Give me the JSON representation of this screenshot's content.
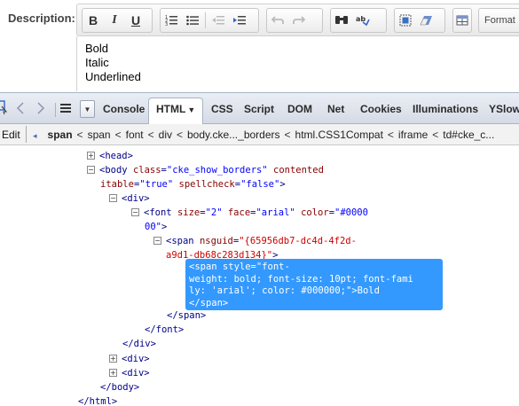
{
  "editor": {
    "description_label": "Description:",
    "toolbar": {
      "bold": "B",
      "italic": "I",
      "underline": "U",
      "format_label": "Format"
    },
    "content_lines": [
      "Bold",
      "Italic",
      "Underlined"
    ]
  },
  "firebug": {
    "tabs": [
      {
        "label": "Console"
      },
      {
        "label": "HTML",
        "active": true
      },
      {
        "label": "CSS"
      },
      {
        "label": "Script"
      },
      {
        "label": "DOM"
      },
      {
        "label": "Net"
      },
      {
        "label": "Cookies"
      },
      {
        "label": "Illuminations"
      },
      {
        "label": "YSlow"
      }
    ],
    "breadcrumb": {
      "edit_label": "Edit",
      "items": [
        "span",
        "span",
        "font",
        "div",
        "body.cke..._borders",
        "html.CSS1Compat",
        "iframe",
        "td#cke_c..."
      ]
    },
    "tree": {
      "head": "<head>",
      "body_open_1": "<body class=\"cke_show_borders\" contented",
      "body_open_2": "itable=\"true\" spellcheck=\"false\">",
      "div_open": "<div>",
      "font_open_1": "<font size=\"2\" face=\"arial\" color=\"#0000",
      "font_open_2": "00\">",
      "span_open_1": "<span nsguid=\"{65956db7-dc4d-4f2d-",
      "span_open_2": "a9d1-db68c283d134}\">",
      "selected_lines": [
        "<span style=\"font-",
        "weight: bold; font-size: 10pt; font-fami",
        "ly: 'arial'; color: #000000;\">Bold",
        "</span>"
      ],
      "span_close": "</span>",
      "font_close": "</font>",
      "div_close": "</div>",
      "div_collapsed_1": "<div>",
      "div_collapsed_2": "<div>",
      "body_close": "</body>",
      "html_close": "</html>"
    }
  }
}
